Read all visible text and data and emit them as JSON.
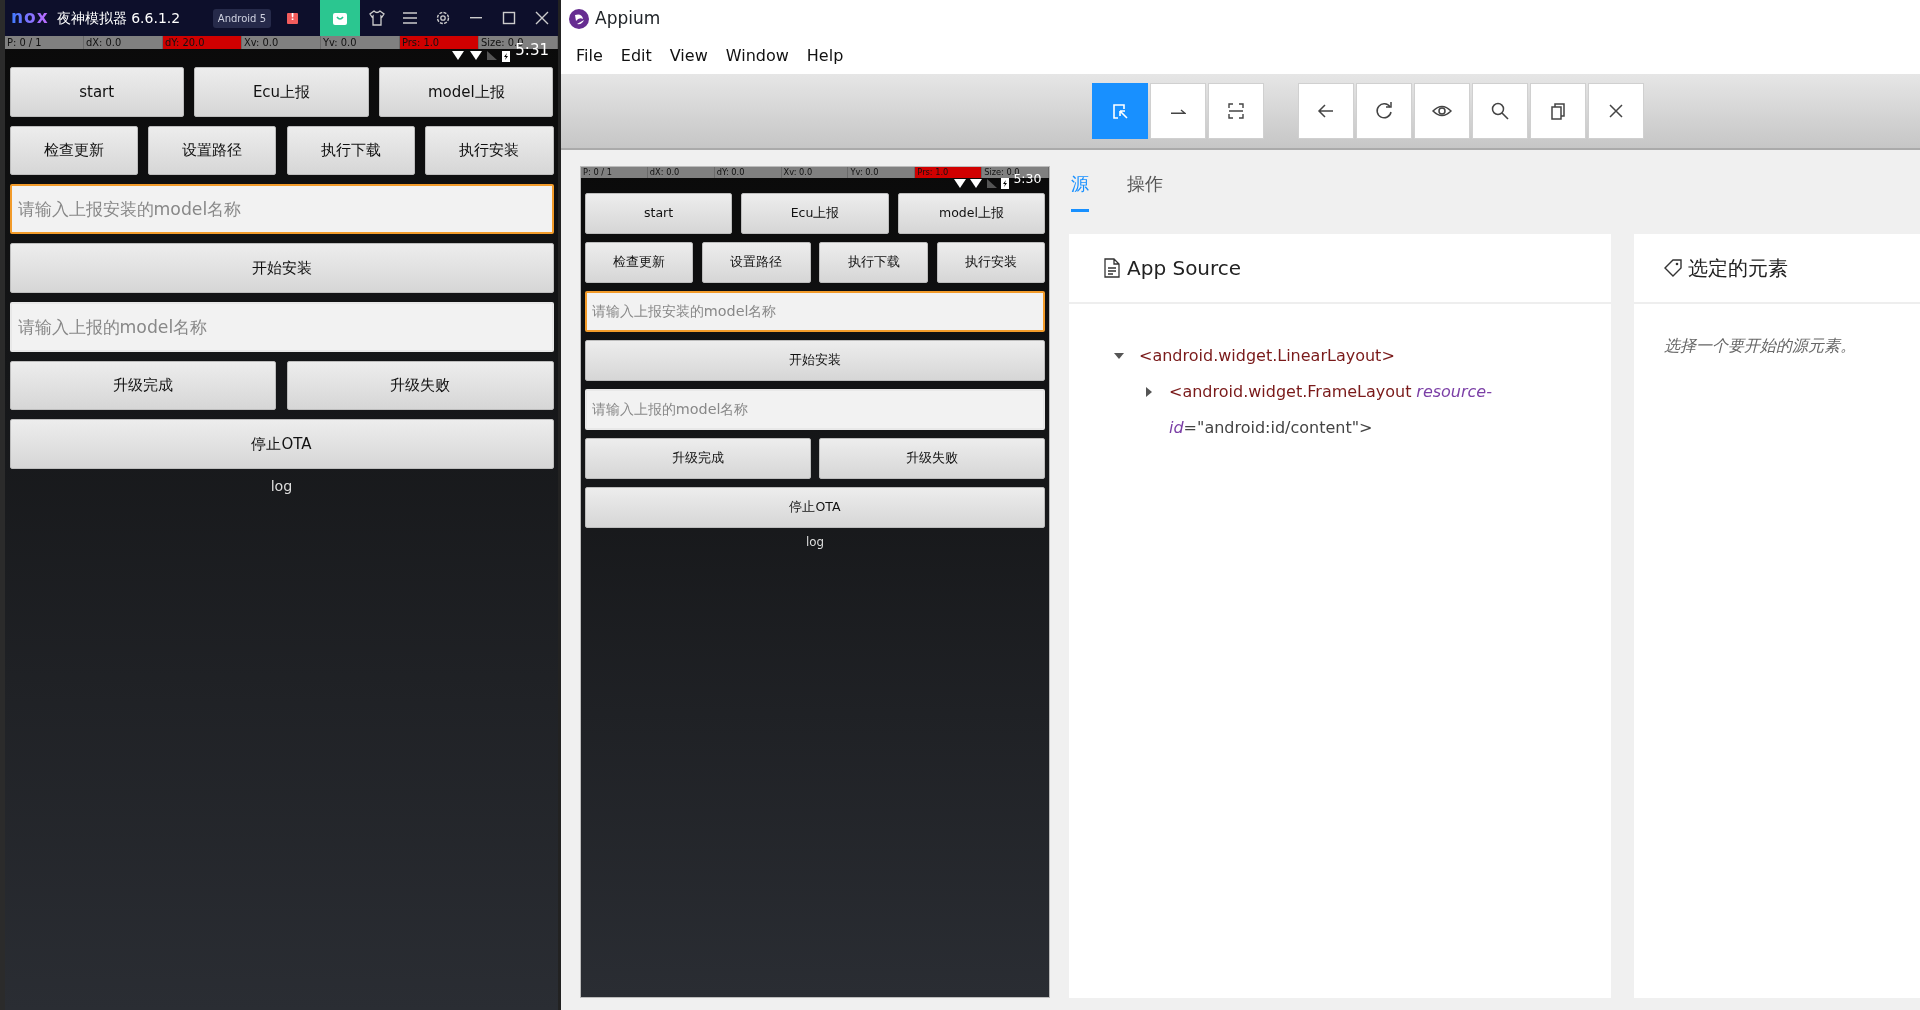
{
  "emulator": {
    "logo": "nox",
    "title": "夜神模拟器 6.6.1.2",
    "badge": "Android 5",
    "alert": "!",
    "tools": [
      {
        "selected": true
      },
      {
        "selected": false
      },
      {
        "selected": false
      },
      {
        "selected": false
      },
      {
        "selected": false
      },
      {
        "selected": false
      },
      {
        "selected": false
      }
    ],
    "phone": {
      "pointer": [
        {
          "text": "P: 0 / 1",
          "highlighted": false
        },
        {
          "text": "dX: 0.0",
          "highlighted": false
        },
        {
          "text": "dY: 20.0",
          "highlighted": true
        },
        {
          "text": "Xv: 0.0",
          "highlighted": false
        },
        {
          "text": "Yv: 0.0",
          "highlighted": false
        },
        {
          "text": "Prs: 1.0",
          "highlighted": true
        },
        {
          "text": "Size: 0.0",
          "highlighted": false
        }
      ],
      "time": "5:31",
      "rows": [
        {
          "kind": "buttons",
          "labels": [
            "start",
            "Ecu上报",
            "model上报"
          ]
        },
        {
          "kind": "buttons",
          "labels": [
            "检查更新",
            "设置路径",
            "执行下载",
            "执行安装"
          ]
        },
        {
          "kind": "input",
          "placeholder": "请输入上报安装的model名称",
          "focused": true
        },
        {
          "kind": "buttons",
          "labels": [
            "开始安装"
          ]
        },
        {
          "kind": "input",
          "placeholder": "请输入上报的model名称",
          "focused": false
        },
        {
          "kind": "buttons",
          "labels": [
            "升级完成",
            "升级失败"
          ]
        },
        {
          "kind": "buttons",
          "labels": [
            "停止OTA"
          ]
        },
        {
          "kind": "text",
          "text": "log"
        }
      ]
    }
  },
  "appium": {
    "title": "Appium",
    "menu": [
      "File",
      "Edit",
      "View",
      "Window",
      "Help"
    ],
    "toolbar": [
      {
        "buttons": [
          {
            "selected": true
          },
          {
            "selected": false
          },
          {
            "selected": false
          }
        ]
      },
      {
        "buttons": [
          {
            "selected": false
          },
          {
            "selected": false
          },
          {
            "selected": false
          },
          {
            "selected": false
          },
          {
            "selected": false
          },
          {
            "selected": false
          }
        ]
      }
    ],
    "phone": {
      "pointer": [
        {
          "text": "P: 0 / 1",
          "highlighted": false
        },
        {
          "text": "dX: 0.0",
          "highlighted": false
        },
        {
          "text": "dY: 0.0",
          "highlighted": false
        },
        {
          "text": "Xv: 0.0",
          "highlighted": false
        },
        {
          "text": "Yv: 0.0",
          "highlighted": false
        },
        {
          "text": "Prs: 1.0",
          "highlighted": true
        },
        {
          "text": "Size: 0.0",
          "highlighted": false
        }
      ],
      "time": "5:30",
      "rows": [
        {
          "kind": "buttons",
          "labels": [
            "start",
            "Ecu上报",
            "model上报"
          ]
        },
        {
          "kind": "buttons",
          "labels": [
            "检查更新",
            "设置路径",
            "执行下载",
            "执行安装"
          ]
        },
        {
          "kind": "input",
          "placeholder": "请输入上报安装的model名称",
          "focused": true
        },
        {
          "kind": "buttons",
          "labels": [
            "开始安装"
          ]
        },
        {
          "kind": "input",
          "placeholder": "请输入上报的model名称",
          "focused": false
        },
        {
          "kind": "buttons",
          "labels": [
            "升级完成",
            "升级失败"
          ]
        },
        {
          "kind": "buttons",
          "labels": [
            "停止OTA"
          ]
        },
        {
          "kind": "text",
          "text": "log"
        }
      ]
    },
    "tabs": [
      {
        "label": "源",
        "selected": true
      },
      {
        "label": "操作",
        "selected": false
      }
    ],
    "source": {
      "title": "App Source",
      "tree": [
        {
          "tag": "<android.widget.LinearLayout>",
          "expanded": true,
          "children": [
            {
              "tag": "<android.widget.FrameLayout",
              "expanded": false,
              "attributes": [
                {
                  "name": "resource-id",
                  "value": "=\"android:id/content\">"
                }
              ]
            }
          ]
        }
      ]
    },
    "selected_element": {
      "title": "选定的元素",
      "hint": "选择一个要开始的源元素。"
    }
  }
}
